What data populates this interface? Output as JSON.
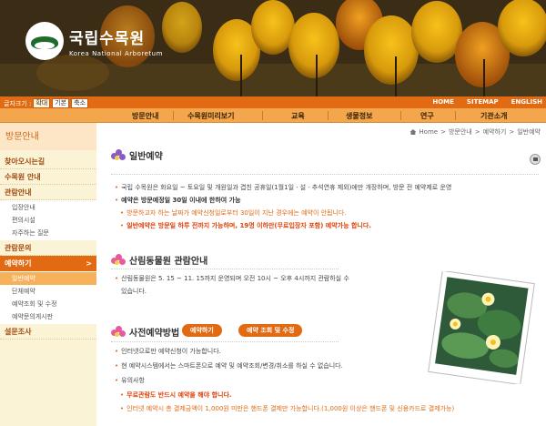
{
  "banner": {
    "logo_ko": "국립수목원",
    "logo_en": "Korea National Arboretum"
  },
  "util": {
    "fontsize_label": "글자크기 :",
    "fontsize_buttons": [
      "확대",
      "기본",
      "축소"
    ],
    "links": [
      "HOME",
      "SITEMAP",
      "ENGLISH"
    ]
  },
  "nav": [
    "방문안내",
    "수목원미리보기",
    "교육",
    "생물정보",
    "연구",
    "기관소개"
  ],
  "breadcrumb": [
    "Home",
    "방문안내",
    "예약하기",
    "일반예약"
  ],
  "sidebar": {
    "title": "방문안내",
    "items": [
      {
        "label": "찾아오시는길"
      },
      {
        "label": "수목원 안내"
      },
      {
        "label": "관람안내",
        "subs": [
          "입장안내",
          "편의시설",
          "자주하는 질문"
        ]
      },
      {
        "label": "관람문의"
      },
      {
        "label": "예약하기",
        "arrow": ">",
        "subs": [
          "일반예약",
          "단체예약",
          "예약조회 및 수정",
          "예약문의게시판"
        ]
      },
      {
        "label": "설문조사"
      }
    ]
  },
  "section1": {
    "title": "일반예약",
    "lines": [
      "국립 수목원은 화요일 ~ 토요일 및 개원일과 겹친 공휴일(1월1일 · 설 · 추석연휴 제외)에만 개장하며, 방문 전 예약제로 운영",
      "예약은 방문예정일 30일 이내에 한하여 가능",
      "방문하고자 하는 날짜가 예약신청일로부터 30일이 지난 경우에는 예약이 안됩니다.",
      "일반예약은 방문일 하루 전까지 가능하며, 19명 이하만(무료입장자 포함) 예약가능 합니다."
    ]
  },
  "section2": {
    "title": "산림동물원 관람안내",
    "lines": [
      "산림동물원은 5. 15 ~ 11. 15까지 운영되며 오전 10시 ~ 오후 4시까지 관람하실 수",
      "있습니다."
    ]
  },
  "section3": {
    "title": "사전예약방법",
    "button_reserve": "예약하기",
    "button_lookup": "예약 조회 및 수정",
    "lines": [
      "인터넷으로만 예약신청이 가능합니다.",
      "현 예약시스템에서는 스마트폰으로 예약 및 예약조회/변경/취소를 하실 수 없습니다.",
      "유의사항",
      "무료관람도 반드시 예약을 해야 합니다.",
      "인터넷 예약시 총 결제금액이 1,000원 미만은 핸드폰 결제만 가능합니다.(1,000원 이상은 핸드폰 및 신용카드로 결제가능)"
    ]
  },
  "colors": {
    "accent": "#e26a12",
    "nav": "#f3a64b",
    "sidebar": "#fbf3d6"
  }
}
